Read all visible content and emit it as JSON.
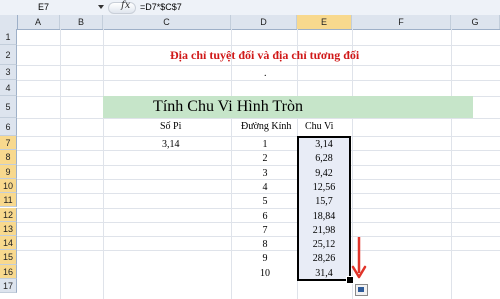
{
  "formula_bar": {
    "cell_ref": "E7",
    "fx_label": "fx",
    "formula": "=D7*$C$7"
  },
  "columns": [
    "A",
    "B",
    "C",
    "D",
    "E",
    "F",
    "G"
  ],
  "rows": [
    "1",
    "2",
    "3",
    "4",
    "5",
    "6",
    "7",
    "8",
    "9",
    "10",
    "11",
    "12",
    "13",
    "14",
    "15",
    "16",
    "17"
  ],
  "sheet": {
    "title": "Địa chỉ tuyệt đối và địa chỉ tương đối",
    "dot": ".",
    "banner": "Tính Chu Vi Hình Tròn",
    "header_pi": "Số Pi",
    "header_diameter": "Đường Kính",
    "header_perimeter": "Chu Vi",
    "pi_value": "3,14",
    "diameters": [
      "1",
      "2",
      "3",
      "4",
      "5",
      "6",
      "7",
      "8",
      "9",
      "10"
    ],
    "perimeters": [
      "3,14",
      "6,28",
      "9,42",
      "12,56",
      "15,7",
      "18,84",
      "21,98",
      "25,12",
      "28,26",
      "31,4"
    ]
  },
  "colors": {
    "title": "#d01818",
    "banner_bg": "#c6e5c9",
    "selected_header": "#f8d98e",
    "arrow": "#e0342a"
  },
  "icons": {
    "fx": "function-icon",
    "arrow": "arrow-down-icon",
    "autofill": "auto-fill-options-icon"
  }
}
